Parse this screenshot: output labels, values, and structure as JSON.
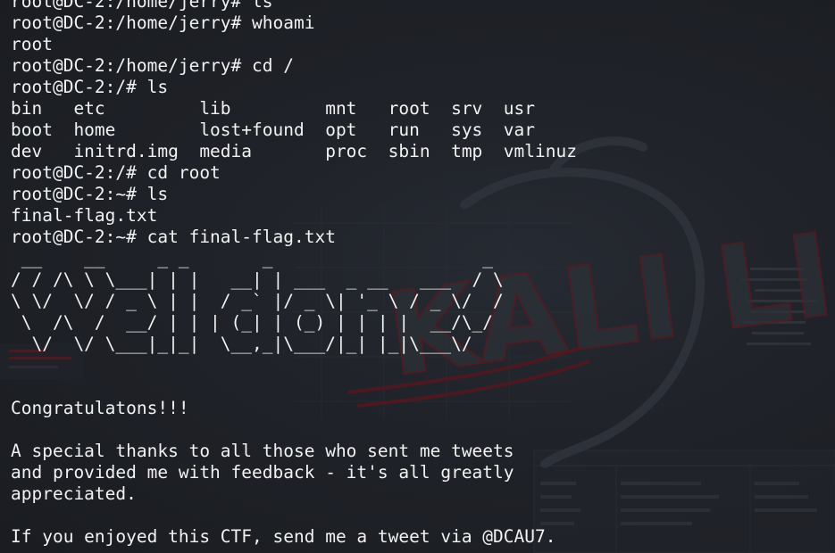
{
  "terminal": {
    "background_color": "#1d1f24",
    "text_color": "#f2f2f2",
    "accent_color": "#8a1620",
    "wallpaper_text": "KALI LINUX",
    "lines": [
      "root@DC-2:/home/jerry# ls",
      "root@DC-2:/home/jerry# whoami",
      "root",
      "root@DC-2:/home/jerry# cd /",
      "root@DC-2:/# ls",
      "bin   etc         lib         mnt   root  srv  usr",
      "boot  home        lost+found  opt   run   sys  var",
      "dev   initrd.img  media       proc  sbin  tmp  vmlinuz",
      "root@DC-2:/# cd root",
      "root@DC-2:~# ls",
      "final-flag.txt",
      "root@DC-2:~# cat final-flag.txt",
      " __    __     _ _       _                    _ ",
      "/ / /\\ \\ \\___| | |   __| | ___  _ __   ___  / \\",
      "\\ \\/  \\/ / _ \\ | |  / _` |/ _ \\| '_ \\ / _ \\/  /",
      " \\  /\\  /  __/ | | | (_| | (_) | | | |  __/\\_/ ",
      "  \\/  \\/ \\___|_|_|  \\__,_|\\___/|_| |_|\\___\\/   ",
      "",
      "",
      "Congratulatons!!!",
      "",
      "A special thanks to all those who sent me tweets",
      "and provided me with feedback - it's all greatly",
      "appreciated.",
      "",
      "If you enjoyed this CTF, send me a tweet via @DCAU7."
    ]
  }
}
